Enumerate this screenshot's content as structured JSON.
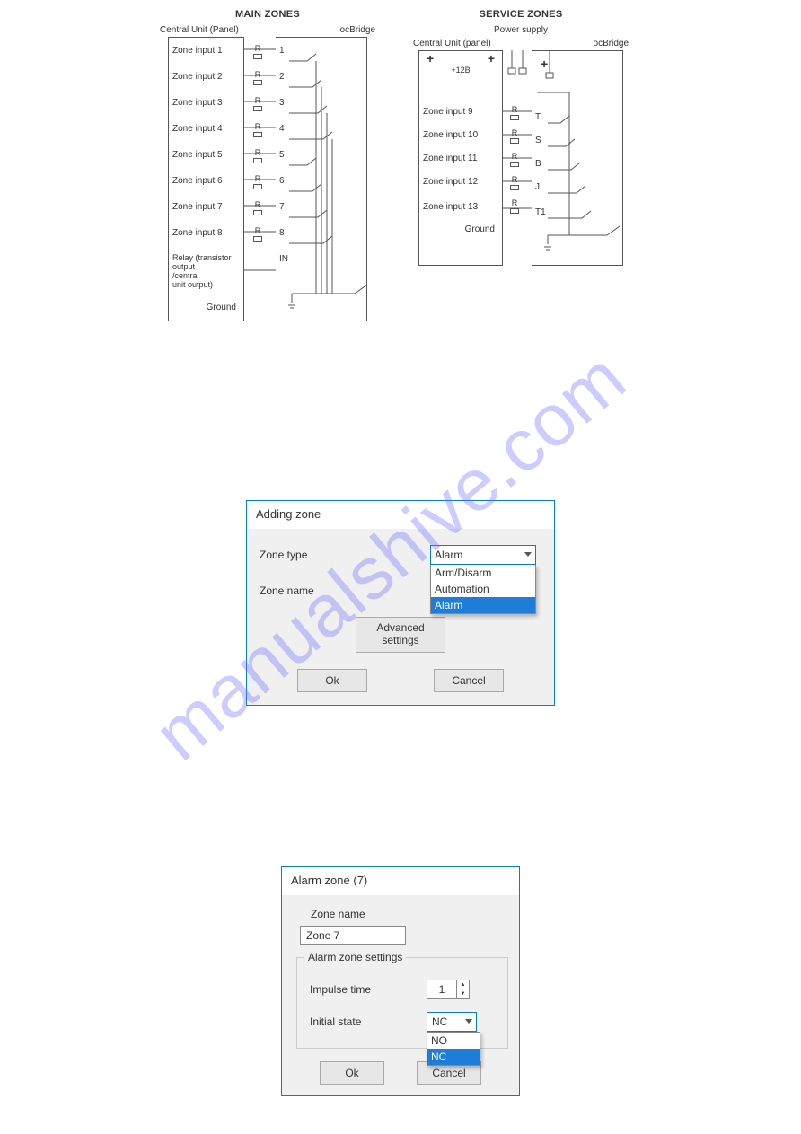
{
  "watermark": "manualshive.com",
  "main_zones": {
    "title": "MAIN ZONES",
    "left_label": "Central Unit (Panel)",
    "right_label": "ocBridge",
    "inputs": [
      "Zone input 1",
      "Zone input 2",
      "Zone input 3",
      "Zone input 4",
      "Zone input 5",
      "Zone input 6",
      "Zone input 7",
      "Zone input 8"
    ],
    "relay_out_lines": [
      "Relay (transistor",
      "output",
      "/central",
      "unit output)"
    ],
    "ground": "Ground",
    "relay_label": "R",
    "pins": [
      "1",
      "2",
      "3",
      "4",
      "5",
      "6",
      "7",
      "8",
      "IN"
    ],
    "gnd_symbol": "⏚"
  },
  "service_zones": {
    "title": "SERVICE ZONES",
    "power_supply": "Power supply",
    "left_label": "Central Unit (panel)",
    "right_label": "ocBridge",
    "plus": "+",
    "minus": "–",
    "v12": "+12B",
    "inputs": [
      "Zone input 9",
      "Zone input 10",
      "Zone input 11",
      "Zone input 12",
      "Zone input 13"
    ],
    "ground": "Ground",
    "relay_label": "R",
    "pins": [
      "T",
      "S",
      "B",
      "J",
      "T1"
    ],
    "gnd_symbol": "⏚"
  },
  "adding_zone": {
    "title": "Adding zone",
    "zone_type_label": "Zone type",
    "zone_type_value": "Alarm",
    "zone_name_label": "Zone name",
    "options": [
      "Arm/Disarm",
      "Automation",
      "Alarm"
    ],
    "selected_option_index": 2,
    "advanced": "Advanced settings",
    "ok": "Ok",
    "cancel": "Cancel"
  },
  "alarm_zone": {
    "title": "Alarm zone (7)",
    "zone_name_label": "Zone name",
    "zone_name_value": "Zone 7",
    "group_title": "Alarm zone settings",
    "impulse_label": "Impulse time",
    "impulse_value": "1",
    "initial_label": "Initial state",
    "initial_value": "NC",
    "options": [
      "NO",
      "NC"
    ],
    "selected_option_index": 1,
    "ok": "Ok",
    "cancel": "Cancel"
  }
}
